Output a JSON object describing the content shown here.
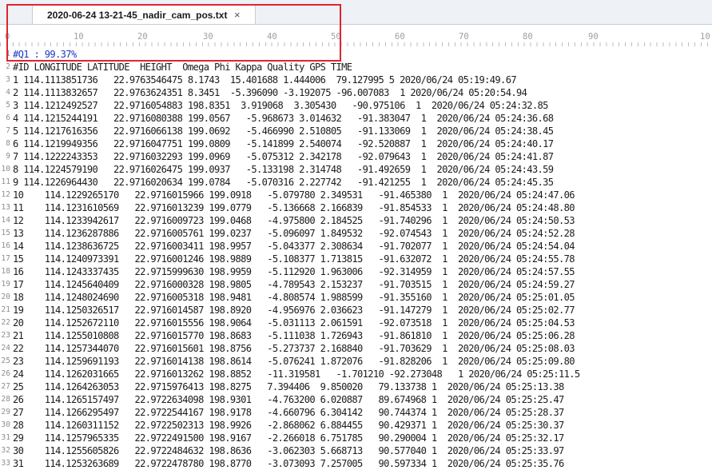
{
  "tab": {
    "title": "2020-06-24 13-21-45_nadir_cam_pos.txt",
    "close_glyph": "×"
  },
  "ruler": {
    "labels": [
      "0",
      "10",
      "20",
      "30",
      "40",
      "50",
      "60",
      "70",
      "80",
      "90",
      "10"
    ]
  },
  "annotation": {
    "color": "#e0242e"
  },
  "lines": [
    "#Q1 : 99.37%",
    "#ID LONGITUDE LATITUDE  HEIGHT  Omega Phi Kappa Quality GPS TIME",
    "1 114.1113851736   22.9763546475 8.1743  15.401688 1.444006  79.127995 5 2020/06/24 05:19:49.67",
    "2 114.1113832657   22.9763624351 8.3451  -5.396090 -3.192075 -96.007083  1 2020/06/24 05:20:54.94",
    "3 114.1212492527   22.9716054883 198.8351  3.919068  3.305430   -90.975106  1  2020/06/24 05:24:32.85",
    "4 114.1215244191   22.9716080388 199.0567   -5.968673 3.014632   -91.383047  1  2020/06/24 05:24:36.68",
    "5 114.1217616356   22.9716066138 199.0692   -5.466990 2.510805   -91.133069  1  2020/06/24 05:24:38.45",
    "6 114.1219949356   22.9716047751 199.0809   -5.141899 2.540074   -92.520887  1  2020/06/24 05:24:40.17",
    "7 114.1222243353   22.9716032293 199.0969   -5.075312 2.342178   -92.079643  1  2020/06/24 05:24:41.87",
    "8 114.1224579190   22.9716026475 199.0937   -5.133198 2.314748   -91.492659  1  2020/06/24 05:24:43.59",
    "9 114.1226964430   22.9716020634 199.0784   -5.070316 2.227742   -91.421255  1  2020/06/24 05:24:45.35",
    "10    114.1229265170   22.9716015966 199.0918   -5.079780 2.349531   -91.465380  1  2020/06/24 05:24:47.06",
    "11    114.1231610569   22.9716013239 199.0779   -5.136668 2.166839   -91.854533  1  2020/06/24 05:24:48.80",
    "12    114.1233942617   22.9716009723 199.0468   -4.975800 2.184525   -91.740296  1  2020/06/24 05:24:50.53",
    "13    114.1236287886   22.9716005761 199.0237   -5.096097 1.849532   -92.074543  1  2020/06/24 05:24:52.28",
    "14    114.1238636725   22.9716003411 198.9957   -5.043377 2.308634   -91.702077  1  2020/06/24 05:24:54.04",
    "15    114.1240973391   22.9716001246 198.9889   -5.108377 1.713815   -91.632072  1  2020/06/24 05:24:55.78",
    "16    114.1243337435   22.9715999630 198.9959   -5.112920 1.963006   -92.314959  1  2020/06/24 05:24:57.55",
    "17    114.1245640409   22.9716000328 198.9805   -4.789543 2.153237   -91.703515  1  2020/06/24 05:24:59.27",
    "18    114.1248024690   22.9716005318 198.9481   -4.808574 1.988599   -91.355160  1  2020/06/24 05:25:01.05",
    "19    114.1250326517   22.9716014587 198.8920   -4.956976 2.036623   -91.147279  1  2020/06/24 05:25:02.77",
    "20    114.1252672110   22.9716015556 198.9064   -5.031113 2.061591   -92.073518  1  2020/06/24 05:25:04.53",
    "21    114.1255010808   22.9716015770 198.8683   -5.111038 1.726943   -91.861810  1  2020/06/24 05:25:06.28",
    "22    114.1257344070   22.9716015601 198.8756   -5.273737 2.168840   -91.703629  1  2020/06/24 05:25:08.03",
    "23    114.1259691193   22.9716014138 198.8614   -5.076241 1.872076   -91.828206  1  2020/06/24 05:25:09.80",
    "24    114.1262031665   22.9716013262 198.8852   -11.319581   -1.701210 -92.273048   1 2020/06/24 05:25:11.5",
    "25    114.1264263053   22.9715976413 198.8275   7.394406  9.850020   79.133738 1  2020/06/24 05:25:13.38",
    "26    114.1265157497   22.9722634098 198.9301   -4.763200 6.020887   89.674968 1  2020/06/24 05:25:25.47",
    "27    114.1266295497   22.9722544167 198.9178   -4.660796 6.304142   90.744374 1  2020/06/24 05:25:28.37",
    "28    114.1260311152   22.9722502313 198.9926   -2.868062 6.884455   90.429371 1  2020/06/24 05:25:30.37",
    "29    114.1257965335   22.9722491500 198.9167   -2.266018 6.751785   90.290004 1  2020/06/24 05:25:32.17",
    "30    114.1255605826   22.9722484632 198.8636   -3.062303 5.668713   90.577040 1  2020/06/24 05:25:33.97",
    "31    114.1253263689   22.9722478780 198.8770   -3.073093 7.257005   90.597334 1  2020/06/24 05:25:35.76"
  ]
}
